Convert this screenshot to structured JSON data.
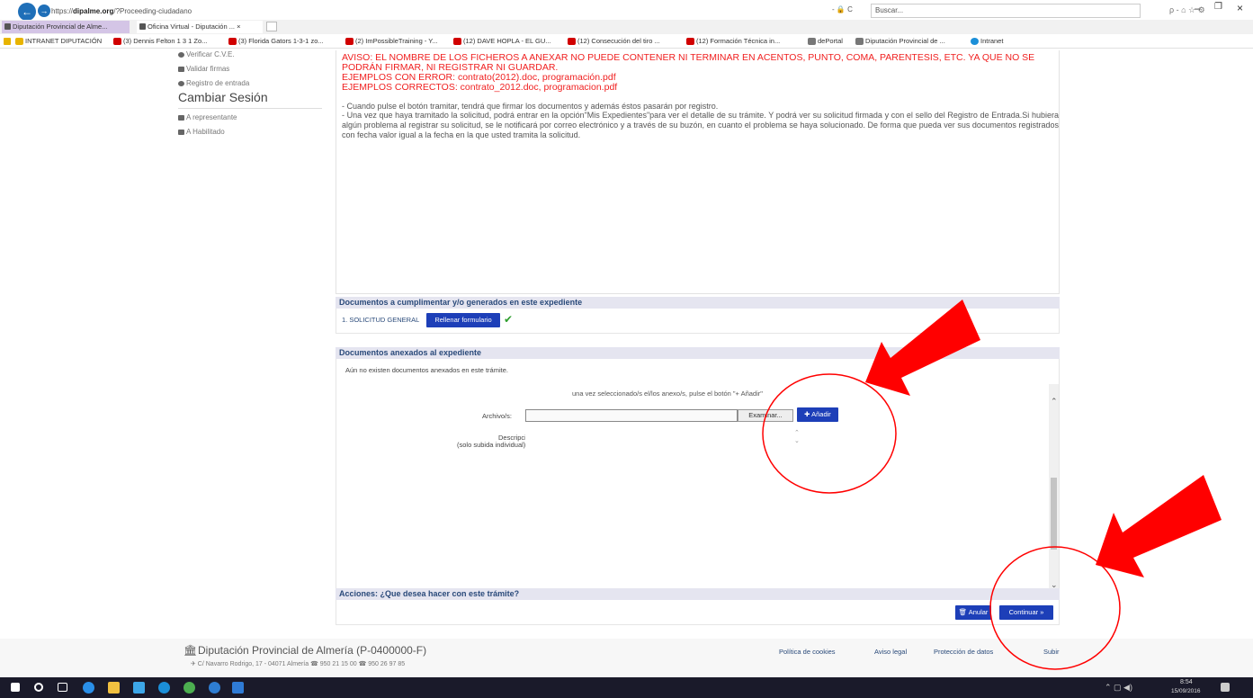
{
  "browser": {
    "url_prefix": "https://",
    "url_domain": "dipalme.org",
    "url_path": "/?Proceeding-ciudadano",
    "search_controls": "- 🔒 C",
    "search_placeholder": "Buscar...",
    "right_controls": "ρ - ⌂ ☆ ⚙",
    "tabs": [
      {
        "label": "Diputación Provincial de Alme..."
      },
      {
        "label": "Oficina Virtual - Diputación ... ×"
      }
    ],
    "favorites": [
      {
        "label": "INTRANET DIPUTACIÓN",
        "icon": "star"
      },
      {
        "label": "(3) Dennis Felton 1 3 1 Zo...",
        "icon": "youtube"
      },
      {
        "label": "(3) Florida Gators 1-3-1 zo...",
        "icon": "youtube"
      },
      {
        "label": "(2) ImPossibleTraining - Y...",
        "icon": "youtube"
      },
      {
        "label": "(12) DAVE HOPLA - EL GU...",
        "icon": "youtube"
      },
      {
        "label": "(12) Consecución del tiro ...",
        "icon": "youtube"
      },
      {
        "label": "(12) Formación Técnica in...",
        "icon": "youtube"
      },
      {
        "label": "dePortal",
        "icon": "doc"
      },
      {
        "label": "Diputación Provincial de ...",
        "icon": "doc"
      },
      {
        "label": "Intranet",
        "icon": "ie"
      }
    ],
    "window_controls": {
      "minimize": "–",
      "maximize": "❐",
      "close": "×"
    }
  },
  "sidebar": {
    "links": [
      {
        "label": "Verificar C.V.E."
      },
      {
        "label": "Validar firmas"
      },
      {
        "label": "Registro de entrada"
      }
    ],
    "section_title": "Cambiar Sesión",
    "session_links": [
      {
        "label": "A representante"
      },
      {
        "label": "A Habilitado"
      }
    ]
  },
  "warning": {
    "lines": [
      "AVISO: EL NOMBRE DE LOS FICHEROS A ANEXAR NO PUEDE CONTENER NI TERMINAR EN ACENTOS, PUNTO, COMA, PARENTESIS, ETC. YA QUE NO SE",
      "PODRÁN FIRMAR, NI REGISTRAR NI GUARDAR.",
      "EJEMPLOS CON ERROR:  contrato(2012).doc, programación.pdf",
      "EJEMPLOS CORRECTOS: contrato_2012.doc, programacion.pdf"
    ],
    "info_1": "- Cuando pulse el botón tramitar, tendrá que firmar los documentos y además éstos pasarán por registro.",
    "info_2": "- Una vez que haya tramitado la solicitud, podrá entrar en la opción\"Mis Expedientes\"para ver el detalle de su trámite. Y podrá ver su solicitud firmada y con el sello del Registro de Entrada.Si hubiera algún problema al registrar su solicitud, se le notificará por correo electrónico y a través de su buzón, en cuanto el problema se haya solucionado. De forma que pueda ver sus documentos registrados con fecha valor igual a la fecha en la que usted tramita la solicitud."
  },
  "documents": {
    "header": "Documentos a cumplimentar y/o generados en este expediente",
    "item_label": "1. SOLICITUD GENERAL",
    "fill_button": "Rellenar formulario",
    "check": "✔"
  },
  "annexes": {
    "header": "Documentos anexados al expediente",
    "empty_text": "Aún no existen documentos anexados en este trámite.",
    "hint": "una vez seleccionado/s el/los anexo/s, pulse el botón \"+ Añadir\"",
    "file_label": "Archivo/s:",
    "file_value": "",
    "browse_button": "Examinar...",
    "add_button": "✚ Añadir",
    "desc_label": "Descripción:",
    "desc_sub": "(solo subida individual)",
    "desc_value": ""
  },
  "actions": {
    "header": "Acciones: ¿Que desea hacer con este trámite?",
    "cancel_button": "🗑 Anular",
    "continue_button": "Continuar »"
  },
  "footer": {
    "org": "Diputación Provincial de Almería (P-0400000-F)",
    "address": "✈ C/ Navarro Rodrigo, 17 - 04071 Almería ☎ 950 21 15 00 ☎ 950 26 97 85",
    "links": [
      "Política de cookies",
      "Aviso legal",
      "Protección de datos",
      "Subir"
    ]
  },
  "taskbar": {
    "time": "8:54",
    "date": "15/09/2016"
  },
  "colors": {
    "warning_red": "#f02020",
    "section_blue": "#2a4a7a",
    "button_blue": "#1d3fb8",
    "annotation_red": "#ff0000"
  }
}
